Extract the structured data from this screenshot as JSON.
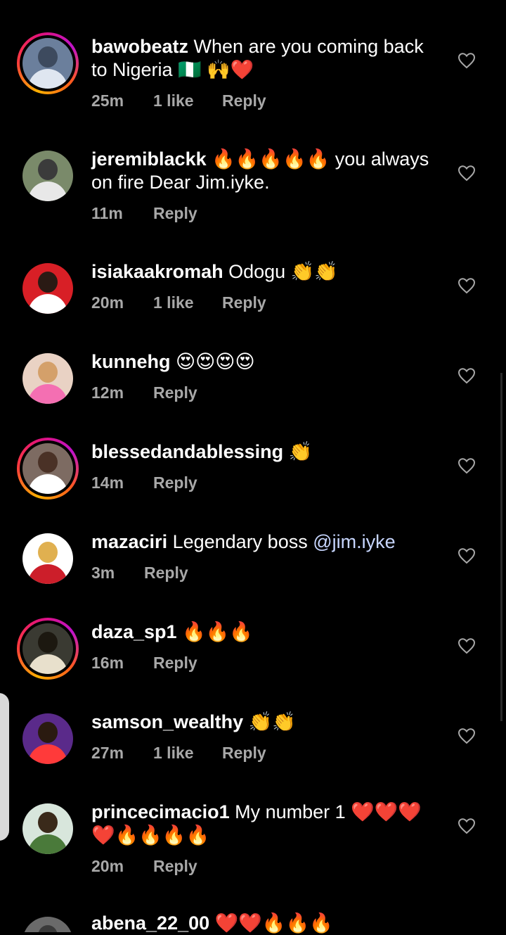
{
  "comments": [
    {
      "username": "bawobeatz",
      "text": " When are you coming back to Nigeria 🇳🇬 🙌❤️",
      "time": "25m",
      "likes": "1 like",
      "reply": "Reply",
      "story_ring": true,
      "avatar_colors": [
        "#6b7f9c",
        "#3d4a5e",
        "#dfe6f0"
      ]
    },
    {
      "username": "jeremiblackk",
      "text": " 🔥🔥🔥🔥🔥 you always on fire  Dear Jim.iyke.",
      "time": "11m",
      "likes": "",
      "reply": "Reply",
      "story_ring": false,
      "avatar_colors": [
        "#7a8a6a",
        "#3b3b3b",
        "#e8e8e8"
      ]
    },
    {
      "username": "isiakaakromah",
      "text": " Odogu 👏👏",
      "time": "20m",
      "likes": "1 like",
      "reply": "Reply",
      "story_ring": false,
      "avatar_colors": [
        "#d81f26",
        "#2a1a14",
        "#ffffff"
      ]
    },
    {
      "username": "kunnehg",
      "text": " 😍😍😍😍",
      "time": "12m",
      "likes": "",
      "reply": "Reply",
      "story_ring": false,
      "avatar_colors": [
        "#e9d2c4",
        "#d4a06a",
        "#f46fb2"
      ]
    },
    {
      "username": "blessedandablessing",
      "text": " 👏",
      "time": "14m",
      "likes": "",
      "reply": "Reply",
      "story_ring": true,
      "avatar_colors": [
        "#7d6b62",
        "#4a3126",
        "#ffffff"
      ]
    },
    {
      "username": "mazaciri",
      "text": " Legendary boss ",
      "mention": "@jim.iyke",
      "time": "3m",
      "likes": "",
      "reply": "Reply",
      "story_ring": false,
      "avatar_colors": [
        "#ffffff",
        "#e0b050",
        "#cc1e2a"
      ]
    },
    {
      "username": "daza_sp1",
      "text": " 🔥🔥🔥",
      "time": "16m",
      "likes": "",
      "reply": "Reply",
      "story_ring": true,
      "avatar_colors": [
        "#3a3a32",
        "#1c1810",
        "#e8e0cc"
      ]
    },
    {
      "username": "samson_wealthy",
      "text": " 👏👏",
      "time": "27m",
      "likes": "1 like",
      "reply": "Reply",
      "story_ring": false,
      "avatar_colors": [
        "#5a2a8a",
        "#2a1a10",
        "#ff3a3a"
      ]
    },
    {
      "username": "princecimacio1",
      "text": " My number 1 ❤️❤️❤️❤️🔥🔥🔥🔥",
      "time": "20m",
      "likes": "",
      "reply": "Reply",
      "story_ring": false,
      "avatar_colors": [
        "#d8e6dc",
        "#3a2a1a",
        "#4a7a3a"
      ]
    },
    {
      "username": "abena_22_00",
      "text": " ❤️❤️🔥🔥🔥",
      "time": "",
      "likes": "",
      "reply": "",
      "story_ring": false,
      "avatar_colors": [
        "#6a6a6a",
        "#3a3a3a",
        "#8a8a8a"
      ]
    }
  ],
  "icons": {
    "like": "heart-outline-icon"
  }
}
